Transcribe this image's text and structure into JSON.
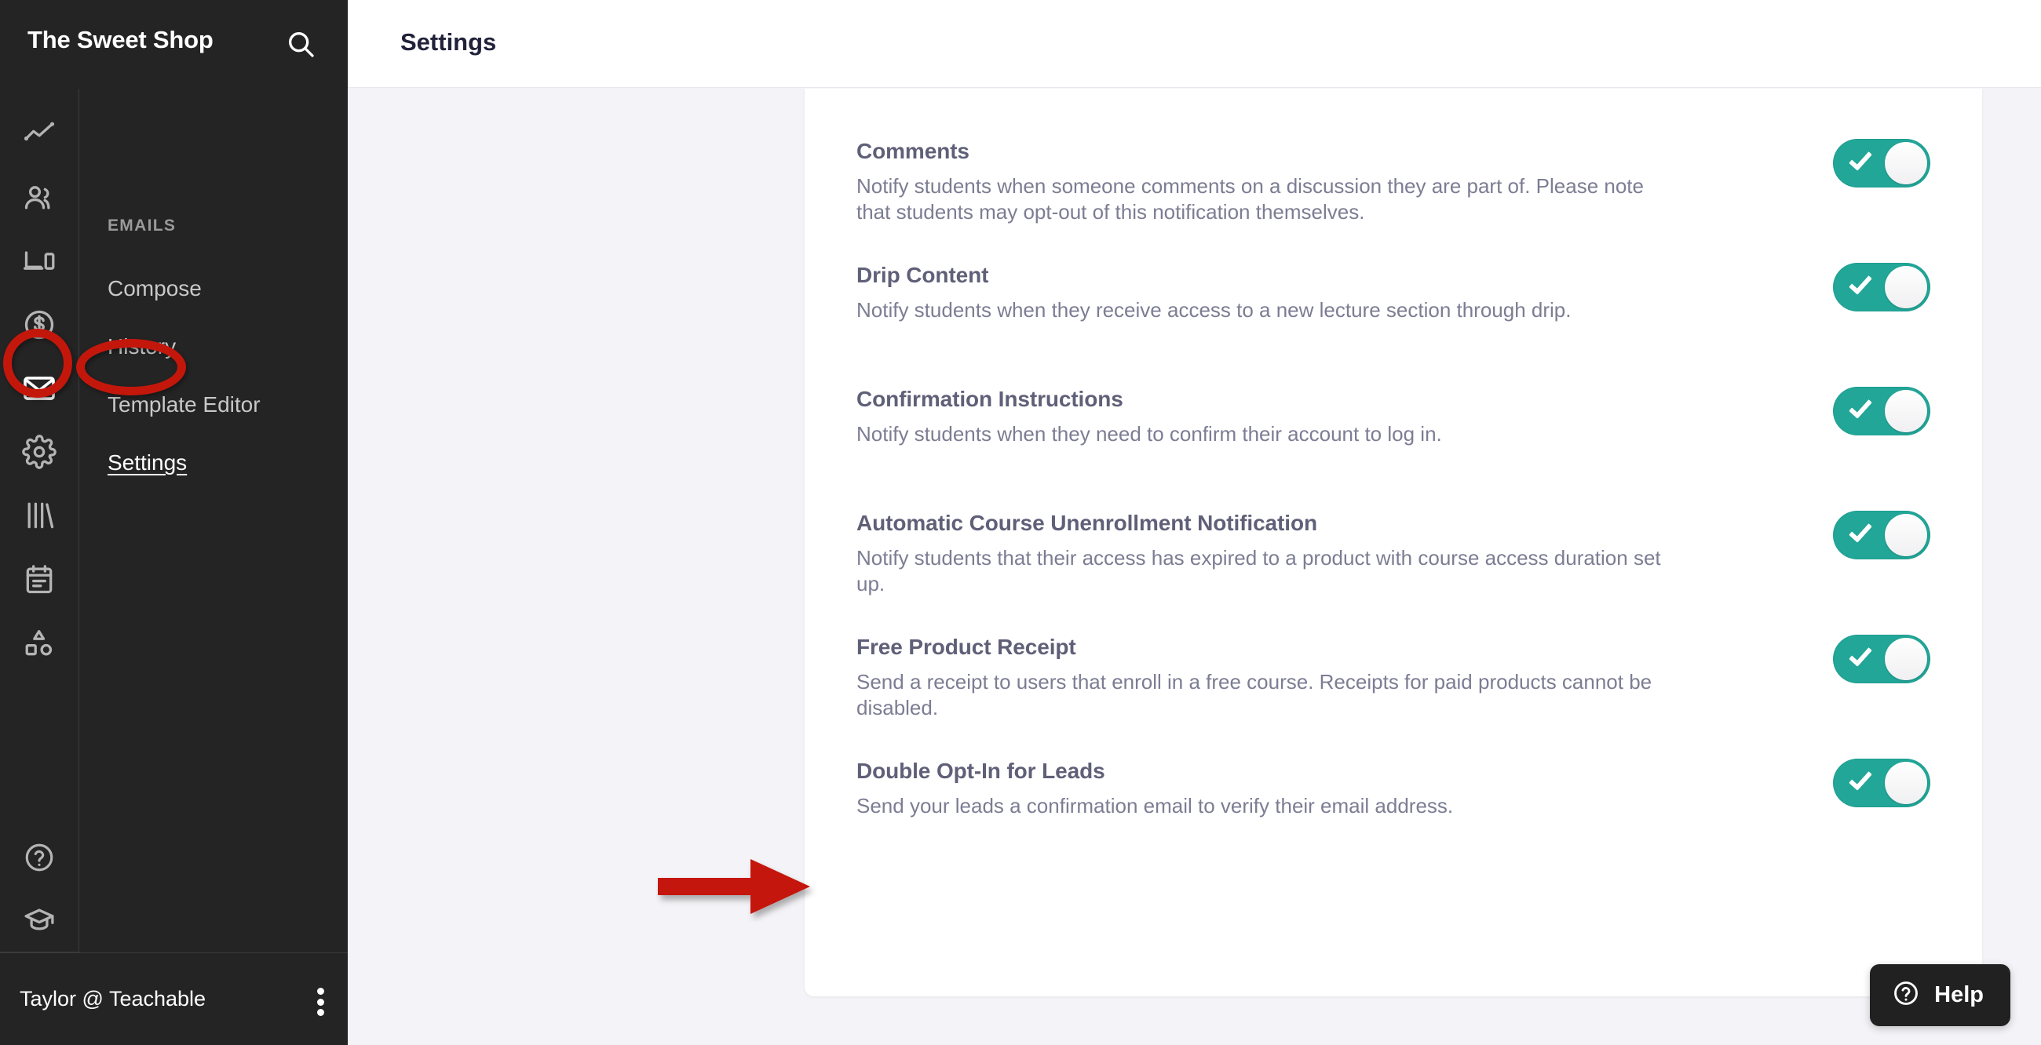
{
  "brand": {
    "title": "The Sweet Shop",
    "search_icon": "search-icon"
  },
  "icon_rail": {
    "items": [
      {
        "name": "analytics-icon",
        "label": "Analytics"
      },
      {
        "name": "users-icon",
        "label": "Users"
      },
      {
        "name": "devices-icon",
        "label": "Site"
      },
      {
        "name": "dollar-circle-icon",
        "label": "Sales"
      },
      {
        "name": "mail-icon",
        "label": "Emails",
        "active": true
      },
      {
        "name": "gear-icon",
        "label": "Settings"
      },
      {
        "name": "library-icon",
        "label": "Library"
      },
      {
        "name": "calendar-notes-icon",
        "label": "Pages"
      },
      {
        "name": "shapes-icon",
        "label": "Design"
      }
    ],
    "bottom_items": [
      {
        "name": "help-circle-icon",
        "label": "Help"
      },
      {
        "name": "graduation-cap-icon",
        "label": "Learn"
      }
    ]
  },
  "subnav": {
    "section_label": "EMAILS",
    "items": [
      {
        "label": "Compose",
        "active": false
      },
      {
        "label": "History",
        "active": false
      },
      {
        "label": "Template Editor",
        "active": false
      },
      {
        "label": "Settings",
        "active": true
      }
    ]
  },
  "user": {
    "name": "Taylor @ Teachable",
    "menu_icon": "kebab-menu-icon"
  },
  "header": {
    "title": "Settings"
  },
  "settings_rows": [
    {
      "title": "Comments",
      "description": "Notify students when someone comments on a discussion they are part of. Please note that students may opt-out of this notification themselves.",
      "enabled": true
    },
    {
      "title": "Drip Content",
      "description": "Notify students when they receive access to a new lecture section through drip.",
      "enabled": true
    },
    {
      "title": "Confirmation Instructions",
      "description": "Notify students when they need to confirm their account to log in.",
      "enabled": true
    },
    {
      "title": "Automatic Course Unenrollment Notification",
      "description": "Notify students that their access has expired to a product with course access duration set up.",
      "enabled": true
    },
    {
      "title": "Free Product Receipt",
      "description": "Send a receipt to users that enroll in a free course. Receipts for paid products cannot be disabled.",
      "enabled": true
    },
    {
      "title": "Double Opt-In for Leads",
      "description": "Send your leads a confirmation email to verify their email address.",
      "enabled": true
    }
  ],
  "help_widget": {
    "label": "Help",
    "icon": "help-circle-icon"
  },
  "annotations": {
    "color": "#c4170c",
    "shapes": [
      {
        "name": "ellipse-around-mail-icon",
        "type": "ellipse"
      },
      {
        "name": "ellipse-around-settings-link",
        "type": "ellipse"
      },
      {
        "name": "arrow-pointing-to-double-opt-in-row",
        "type": "arrow"
      }
    ]
  },
  "colors": {
    "sidebar_bg": "#242424",
    "content_bg": "#f4f3f7",
    "card_bg": "#ffffff",
    "toggle_on": "#21a698",
    "title_text": "#5f6078",
    "body_text": "#7c7d93",
    "annotation_red": "#c4170c"
  }
}
